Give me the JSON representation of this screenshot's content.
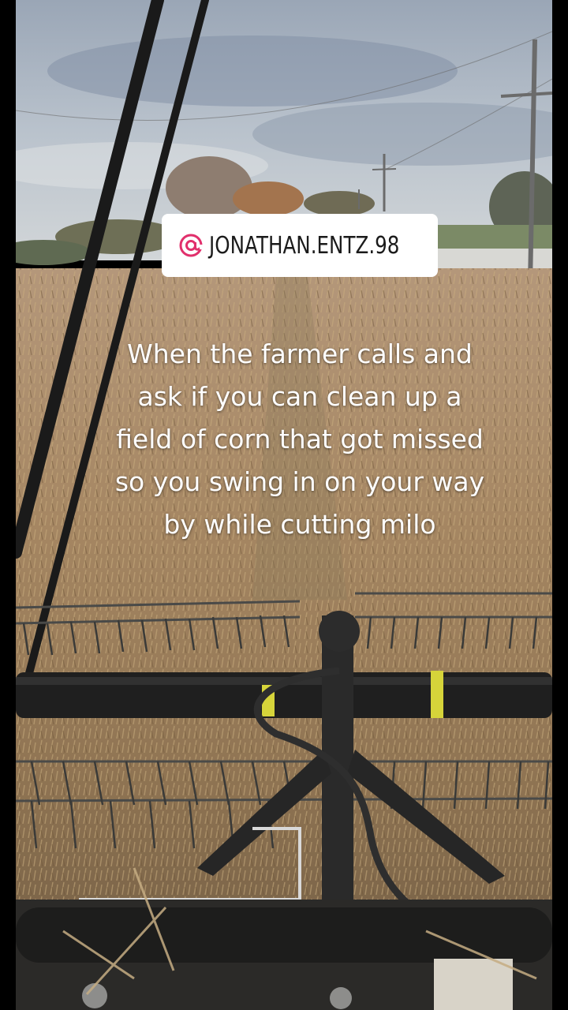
{
  "overlay": {
    "handle_icon": "instagram-at-icon",
    "handle": "JONATHAN.ENTZ.98",
    "caption_lines": [
      "When the farmer calls and",
      "ask if you can clean up a",
      "field of corn that got missed",
      "so you swing in on your way",
      "by while cutting milo"
    ]
  },
  "colors": {
    "handle_accent": "#e1306c",
    "pill_background": "#ffffff",
    "caption_text": "#ffffff"
  },
  "scene": {
    "description_icon": "combine-header-photo"
  }
}
